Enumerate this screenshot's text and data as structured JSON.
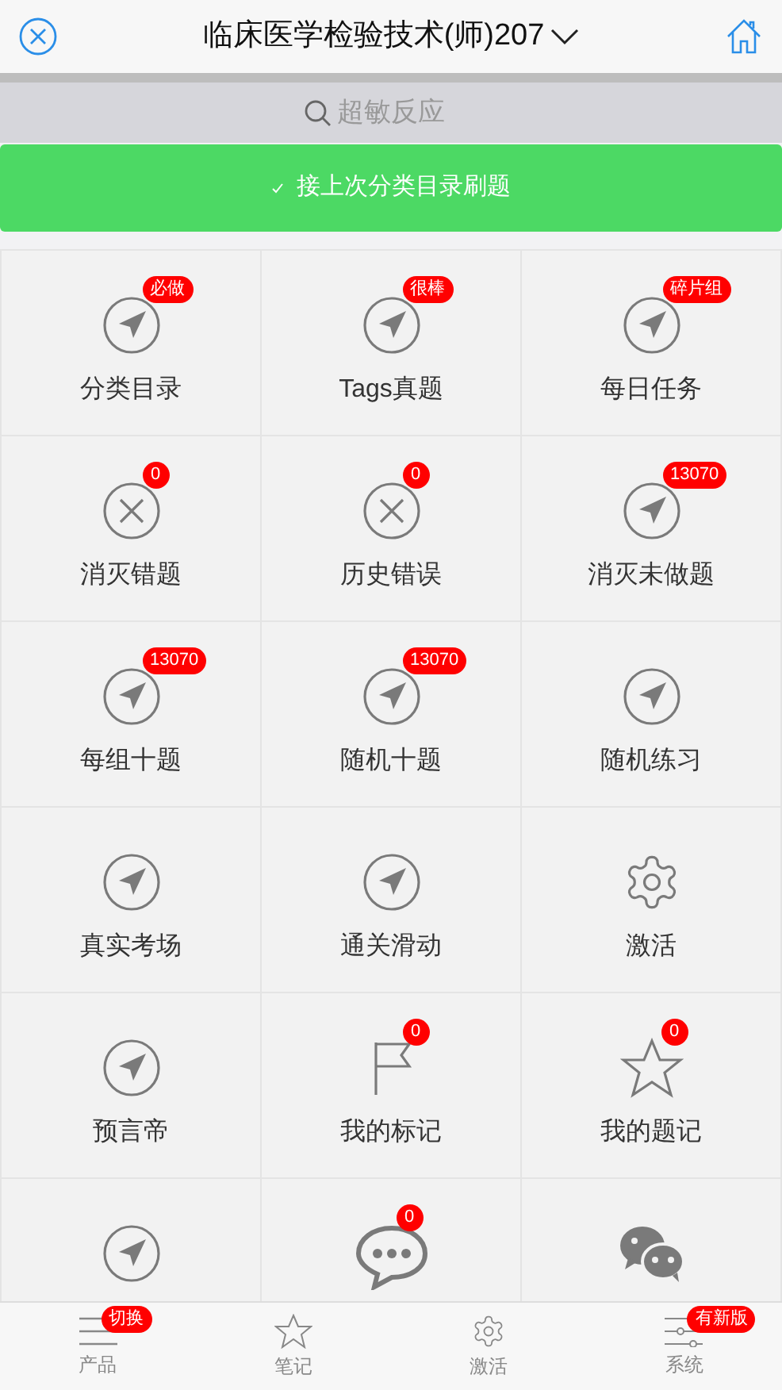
{
  "header": {
    "title": "临床医学检验技术(师)207"
  },
  "search": {
    "placeholder": "超敏反应"
  },
  "resume_button": {
    "label": "接上次分类目录刷题"
  },
  "tiles": [
    {
      "kind": "arrow",
      "label": "分类目录",
      "badge": "必做"
    },
    {
      "kind": "arrow",
      "label": "Tags真题",
      "badge": "很棒"
    },
    {
      "kind": "arrow",
      "label": "每日任务",
      "badge": "碎片组"
    },
    {
      "kind": "cross",
      "label": "消灭错题",
      "badge": "0"
    },
    {
      "kind": "cross",
      "label": "历史错误",
      "badge": "0"
    },
    {
      "kind": "arrow",
      "label": "消灭未做题",
      "badge": "13070"
    },
    {
      "kind": "arrow",
      "label": "每组十题",
      "badge": "13070"
    },
    {
      "kind": "arrow",
      "label": "随机十题",
      "badge": "13070"
    },
    {
      "kind": "arrow",
      "label": "随机练习"
    },
    {
      "kind": "arrow",
      "label": "真实考场"
    },
    {
      "kind": "arrow",
      "label": "通关滑动"
    },
    {
      "kind": "gear",
      "label": "激活"
    },
    {
      "kind": "arrow",
      "label": "预言帝"
    },
    {
      "kind": "flag",
      "label": "我的标记",
      "badge": "0"
    },
    {
      "kind": "star",
      "label": "我的题记",
      "badge": "0"
    },
    {
      "kind": "arrow"
    },
    {
      "kind": "chat",
      "badge": "0"
    },
    {
      "kind": "wechat"
    }
  ],
  "tab_bar": [
    {
      "kind": "menu",
      "label": "产品",
      "badge": "切换"
    },
    {
      "kind": "star",
      "label": "笔记"
    },
    {
      "kind": "gear",
      "label": "激活"
    },
    {
      "kind": "sliders",
      "label": "系统",
      "badge": "有新版"
    }
  ]
}
